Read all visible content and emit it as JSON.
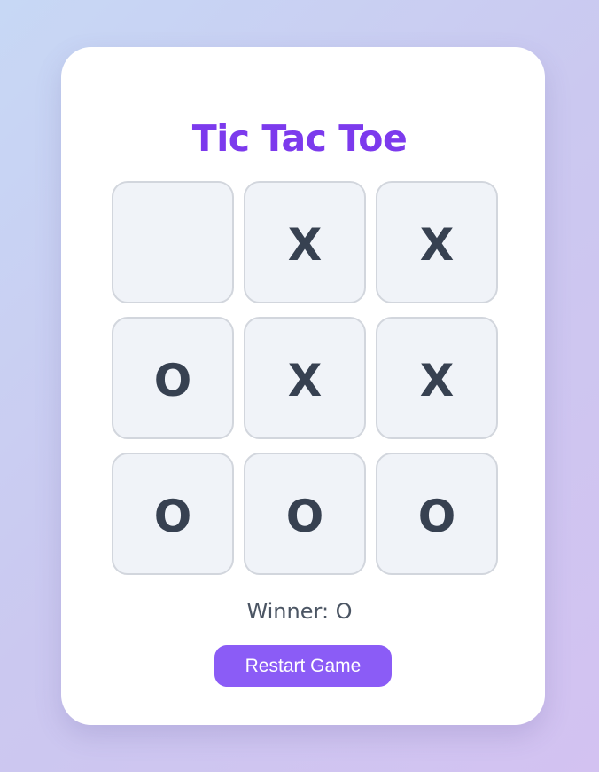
{
  "game": {
    "title": "Tic Tac Toe",
    "board": [
      "",
      "X",
      "X",
      "O",
      "X",
      "X",
      "O",
      "O",
      "O"
    ],
    "status": "Winner: O",
    "restart_label": "Restart Game"
  },
  "colors": {
    "title": "#7c3aed",
    "button": "#8b5cf6",
    "cell_background": "#f0f3f8",
    "mark": "#374151"
  }
}
